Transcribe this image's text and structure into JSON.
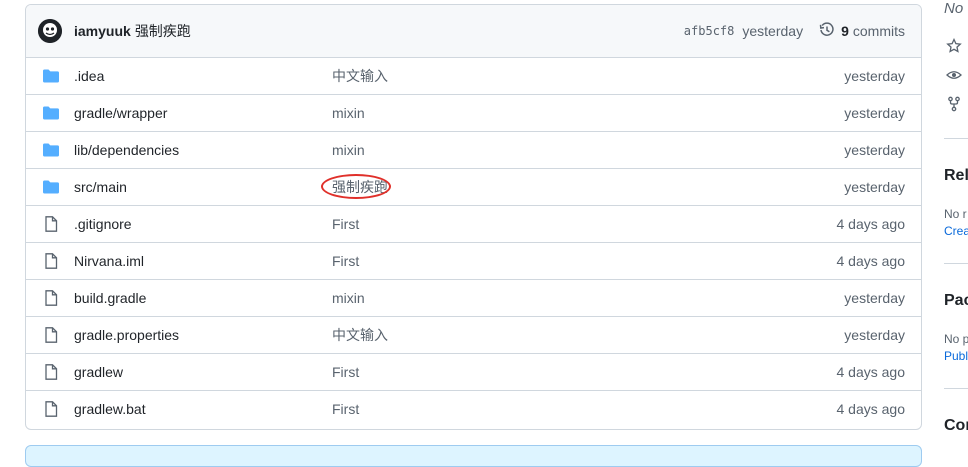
{
  "commit": {
    "author": "iamyuuk",
    "message": "强制疾跑",
    "sha": "afb5cf8",
    "time": "yesterday",
    "commit_count": "9",
    "commits_label": "commits"
  },
  "files": [
    {
      "type": "folder",
      "name": ".idea",
      "message": "中文输入",
      "age": "yesterday"
    },
    {
      "type": "folder",
      "name": "gradle/wrapper",
      "message": "mixin",
      "age": "yesterday"
    },
    {
      "type": "folder",
      "name": "lib/dependencies",
      "message": "mixin",
      "age": "yesterday"
    },
    {
      "type": "folder",
      "name": "src/main",
      "message": "强制疾跑",
      "age": "yesterday",
      "highlighted": true
    },
    {
      "type": "file",
      "name": ".gitignore",
      "message": "First",
      "age": "4 days ago"
    },
    {
      "type": "file",
      "name": "Nirvana.iml",
      "message": "First",
      "age": "4 days ago"
    },
    {
      "type": "file",
      "name": "build.gradle",
      "message": "mixin",
      "age": "yesterday"
    },
    {
      "type": "file",
      "name": "gradle.properties",
      "message": "中文输入",
      "age": "yesterday"
    },
    {
      "type": "file",
      "name": "gradlew",
      "message": "First",
      "age": "4 days ago"
    },
    {
      "type": "file",
      "name": "gradlew.bat",
      "message": "First",
      "age": "4 days ago"
    }
  ],
  "sidebar": {
    "about_desc": "No",
    "releases_title": "Rele",
    "releases_text": "No r",
    "releases_link": "Crea",
    "packages_title": "Pac",
    "packages_text": "No p",
    "packages_link": "Publ",
    "contributors_title": "Cor"
  },
  "colors": {
    "folder": "#54aeff",
    "accent": "#0969da",
    "annotation": "#e0302a"
  }
}
